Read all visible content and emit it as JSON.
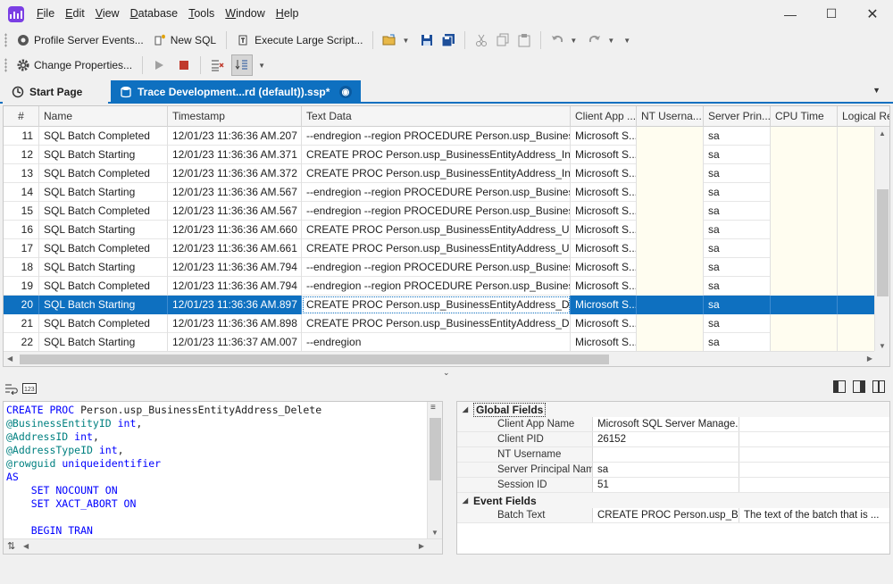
{
  "menu": [
    "File",
    "Edit",
    "View",
    "Database",
    "Tools",
    "Window",
    "Help"
  ],
  "toolbar1": {
    "profile_server_events": "Profile Server Events...",
    "new_sql": "New SQL",
    "execute_large_script": "Execute Large Script..."
  },
  "toolbar2": {
    "change_properties": "Change Properties..."
  },
  "tabs": {
    "start_page": "Start Page",
    "trace": "Trace Development...rd (default)).ssp*"
  },
  "grid": {
    "columns": [
      "#",
      "Name",
      "Timestamp",
      "Text Data",
      "Client App ...",
      "NT Userna...",
      "Server Prin...",
      "CPU Time",
      "Logical Rea"
    ],
    "rows": [
      {
        "n": "11",
        "name": "SQL Batch Completed",
        "ts": "12/01/23 11:36:36 AM.207",
        "text": "--endregion  --region PROCEDURE Person.usp_BusinessE...",
        "client": "Microsoft S...",
        "nt": "",
        "server": "sa",
        "cpu": "",
        "logical": ""
      },
      {
        "n": "12",
        "name": "SQL Batch Starting",
        "ts": "12/01/23 11:36:36 AM.371",
        "text": "CREATE PROC Person.usp_BusinessEntityAddress_Insert ...",
        "client": "Microsoft S...",
        "nt": "",
        "server": "sa",
        "cpu": "",
        "logical": ""
      },
      {
        "n": "13",
        "name": "SQL Batch Completed",
        "ts": "12/01/23 11:36:36 AM.372",
        "text": "CREATE PROC Person.usp_BusinessEntityAddress_Insert ...",
        "client": "Microsoft S...",
        "nt": "",
        "server": "sa",
        "cpu": "",
        "logical": ""
      },
      {
        "n": "14",
        "name": "SQL Batch Starting",
        "ts": "12/01/23 11:36:36 AM.567",
        "text": "--endregion  --region PROCEDURE Person.usp_BusinessE...",
        "client": "Microsoft S...",
        "nt": "",
        "server": "sa",
        "cpu": "",
        "logical": ""
      },
      {
        "n": "15",
        "name": "SQL Batch Completed",
        "ts": "12/01/23 11:36:36 AM.567",
        "text": "--endregion  --region PROCEDURE Person.usp_BusinessE...",
        "client": "Microsoft S...",
        "nt": "",
        "server": "sa",
        "cpu": "",
        "logical": ""
      },
      {
        "n": "16",
        "name": "SQL Batch Starting",
        "ts": "12/01/23 11:36:36 AM.660",
        "text": "CREATE PROC Person.usp_BusinessEntityAddress_Updat...",
        "client": "Microsoft S...",
        "nt": "",
        "server": "sa",
        "cpu": "",
        "logical": ""
      },
      {
        "n": "17",
        "name": "SQL Batch Completed",
        "ts": "12/01/23 11:36:36 AM.661",
        "text": "CREATE PROC Person.usp_BusinessEntityAddress_Updat...",
        "client": "Microsoft S...",
        "nt": "",
        "server": "sa",
        "cpu": "",
        "logical": ""
      },
      {
        "n": "18",
        "name": "SQL Batch Starting",
        "ts": "12/01/23 11:36:36 AM.794",
        "text": "--endregion  --region PROCEDURE Person.usp_BusinessE...",
        "client": "Microsoft S...",
        "nt": "",
        "server": "sa",
        "cpu": "",
        "logical": ""
      },
      {
        "n": "19",
        "name": "SQL Batch Completed",
        "ts": "12/01/23 11:36:36 AM.794",
        "text": "--endregion  --region PROCEDURE Person.usp_BusinessE...",
        "client": "Microsoft S...",
        "nt": "",
        "server": "sa",
        "cpu": "",
        "logical": ""
      },
      {
        "n": "20",
        "name": "SQL Batch Starting",
        "ts": "12/01/23 11:36:36 AM.897",
        "text": "CREATE PROC Person.usp_BusinessEntityAddress_Delete...",
        "client": "Microsoft S...",
        "nt": "",
        "server": "sa",
        "cpu": "",
        "logical": "",
        "selected": true
      },
      {
        "n": "21",
        "name": "SQL Batch Completed",
        "ts": "12/01/23 11:36:36 AM.898",
        "text": "CREATE PROC Person.usp_BusinessEntityAddress_Delete...",
        "client": "Microsoft S...",
        "nt": "",
        "server": "sa",
        "cpu": "",
        "logical": ""
      },
      {
        "n": "22",
        "name": "SQL Batch Starting",
        "ts": "12/01/23 11:36:37 AM.007",
        "text": "--endregion",
        "client": "Microsoft S...",
        "nt": "",
        "server": "sa",
        "cpu": "",
        "logical": ""
      }
    ]
  },
  "code": {
    "lines": [
      [
        {
          "t": "kw",
          "v": "CREATE PROC "
        },
        {
          "t": "plain",
          "v": "Person.usp_BusinessEntityAddress_Delete"
        }
      ],
      [
        {
          "t": "param",
          "v": "@BusinessEntityID "
        },
        {
          "t": "kw",
          "v": "int"
        },
        {
          "t": "plain",
          "v": ","
        }
      ],
      [
        {
          "t": "param",
          "v": "@AddressID "
        },
        {
          "t": "kw",
          "v": "int"
        },
        {
          "t": "plain",
          "v": ","
        }
      ],
      [
        {
          "t": "param",
          "v": "@AddressTypeID "
        },
        {
          "t": "kw",
          "v": "int"
        },
        {
          "t": "plain",
          "v": ","
        }
      ],
      [
        {
          "t": "param",
          "v": "@rowguid "
        },
        {
          "t": "kw",
          "v": "uniqueidentifier"
        }
      ],
      [
        {
          "t": "kw",
          "v": "AS"
        }
      ],
      [
        {
          "t": "kw",
          "v": "    SET NOCOUNT ON"
        }
      ],
      [
        {
          "t": "kw",
          "v": "    SET XACT_ABORT ON"
        }
      ],
      [
        {
          "t": "plain",
          "v": ""
        }
      ],
      [
        {
          "t": "kw",
          "v": "    BEGIN TRAN"
        }
      ]
    ]
  },
  "props": {
    "global_title": "Global Fields",
    "global_fields": [
      {
        "name": "Client App Name",
        "value": "Microsoft SQL Server Manage...",
        "desc": ""
      },
      {
        "name": "Client PID",
        "value": "26152",
        "desc": ""
      },
      {
        "name": "NT Username",
        "value": "",
        "desc": ""
      },
      {
        "name": "Server Principal Name",
        "value": "sa",
        "desc": ""
      },
      {
        "name": "Session ID",
        "value": "51",
        "desc": ""
      }
    ],
    "event_title": "Event Fields",
    "event_fields": [
      {
        "name": "Batch Text",
        "value": "CREATE PROC Person.usp_B...",
        "desc": "The text of the batch that is ..."
      }
    ]
  },
  "colors": {
    "accent": "#0e70c0",
    "logo": "#7b3fe4",
    "keyword": "#0000ff",
    "param": "#008080"
  }
}
